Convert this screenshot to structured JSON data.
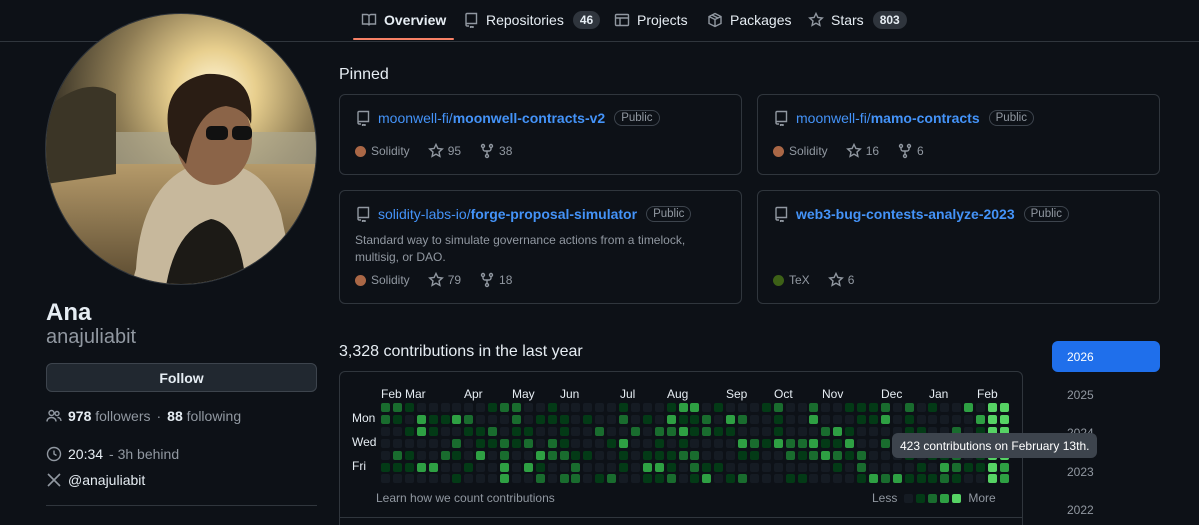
{
  "nav": {
    "tabs": [
      {
        "label": "Overview",
        "icon": "book-icon",
        "active": true
      },
      {
        "label": "Repositories",
        "icon": "repo-icon",
        "count": "46"
      },
      {
        "label": "Projects",
        "icon": "table-icon"
      },
      {
        "label": "Packages",
        "icon": "package-icon"
      },
      {
        "label": "Stars",
        "icon": "star-icon",
        "count": "803"
      }
    ]
  },
  "profile": {
    "name": "Ana",
    "login": "anajuliabit",
    "follow_label": "Follow",
    "followers_count": "978",
    "followers_label": "followers",
    "separator": "·",
    "following_count": "88",
    "following_label": "following",
    "local_time": "20:34",
    "time_note": "- 3h behind",
    "x_handle": "@anajuliabit"
  },
  "pinned": {
    "title": "Pinned",
    "cards": [
      {
        "owner": "moonwell-fi/",
        "name": "moonwell-contracts-v2",
        "visibility": "Public",
        "description": "",
        "language": "Solidity",
        "lang_color": "#AA6746",
        "stars": "95",
        "forks": "38"
      },
      {
        "owner": "moonwell-fi/",
        "name": "mamo-contracts",
        "visibility": "Public",
        "description": "",
        "language": "Solidity",
        "lang_color": "#AA6746",
        "stars": "16",
        "forks": "6"
      },
      {
        "owner": "solidity-labs-io/",
        "name": "forge-proposal-simulator",
        "visibility": "Public",
        "description": "Standard way to simulate governance actions from a timelock, multisig, or DAO.",
        "language": "Solidity",
        "lang_color": "#AA6746",
        "stars": "79",
        "forks": "18"
      },
      {
        "owner": "",
        "name": "web3-bug-contests-analyze-2023",
        "visibility": "Public",
        "description": "",
        "language": "TeX",
        "lang_color": "#3D6117",
        "stars": "6",
        "forks": ""
      }
    ]
  },
  "contributions": {
    "title": "3,328 contributions in the last year",
    "months": [
      "Feb",
      "Mar",
      "Apr",
      "May",
      "Jun",
      "Jul",
      "Aug",
      "Sep",
      "Oct",
      "Nov",
      "Dec",
      "Jan",
      "Feb"
    ],
    "day_labels": [
      "Mon",
      "Wed",
      "Fri"
    ],
    "learn_link": "Learn how we count contributions",
    "legend_less": "Less",
    "legend_more": "More",
    "tooltip": "423 contributions on February 13th.",
    "colors": [
      "#151b23",
      "#033a16",
      "#196c2e",
      "#2ea043",
      "#56d364"
    ]
  },
  "years": [
    {
      "label": "2026",
      "active": true
    },
    {
      "label": "2025"
    },
    {
      "label": "2024"
    },
    {
      "label": "2023"
    },
    {
      "label": "2022"
    }
  ]
}
